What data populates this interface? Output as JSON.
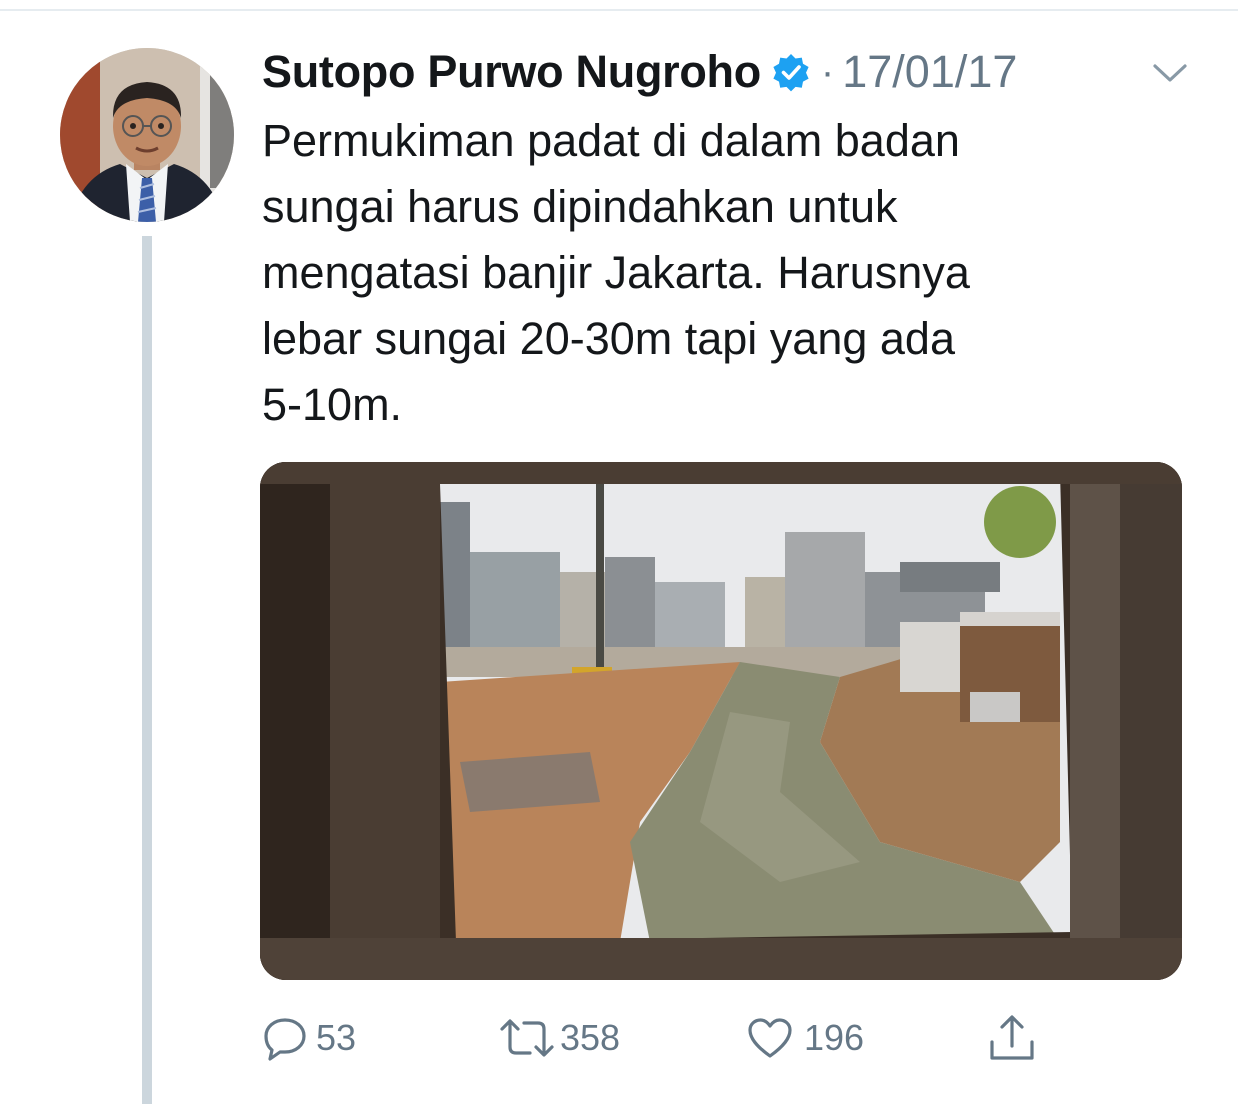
{
  "tweet": {
    "author_name": "Sutopo Purwo Nugroho",
    "separator": "·",
    "date": "17/01/17",
    "text_lines": [
      "Permukiman padat di dalam badan",
      "sungai harus dipindahkan untuk",
      "mengatasi banjir Jakarta. Harusnya",
      "lebar sungai 20-30m tapi yang ada",
      "5-10m."
    ]
  },
  "actions": {
    "reply_count": "53",
    "retweet_count": "358",
    "like_count": "196"
  },
  "icons": {
    "verified": "verified-badge-icon",
    "menu": "chevron-down-icon",
    "reply": "reply-icon",
    "retweet": "retweet-icon",
    "like": "heart-icon",
    "share": "share-icon"
  },
  "colors": {
    "text": "#14171a",
    "secondary": "#657786",
    "verified": "#1da1f2",
    "thread_line": "#ccd6dd"
  }
}
